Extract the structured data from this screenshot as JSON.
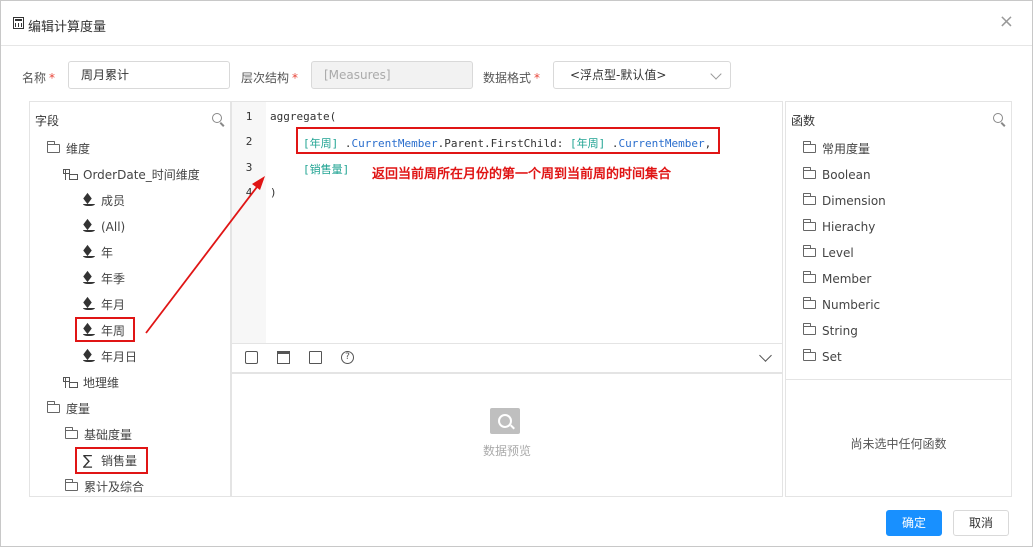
{
  "dialog": {
    "title": "编辑计算度量",
    "close_label": "×"
  },
  "form": {
    "name_label": "名称",
    "name_value": "周月累计",
    "hierarchy_label": "层次结构",
    "hierarchy_value": "[Measures]",
    "format_label": "数据格式",
    "format_value": "<浮点型-默认值>",
    "required_mark": "*"
  },
  "fields_panel": {
    "title": "字段",
    "items": [
      {
        "label": "维度",
        "icon": "folder-icon"
      },
      {
        "label": "OrderDate_时间维度",
        "icon": "hierarchy-icon"
      },
      {
        "label": "成员",
        "icon": "layers-icon"
      },
      {
        "label": "(All)",
        "icon": "layers-icon"
      },
      {
        "label": "年",
        "icon": "layers-icon"
      },
      {
        "label": "年季",
        "icon": "layers-icon"
      },
      {
        "label": "年月",
        "icon": "layers-icon"
      },
      {
        "label": "年周",
        "icon": "layers-icon"
      },
      {
        "label": "年月日",
        "icon": "layers-icon"
      },
      {
        "label": "地理维",
        "icon": "hierarchy-icon"
      },
      {
        "label": "度量",
        "icon": "folder-icon"
      },
      {
        "label": "基础度量",
        "icon": "folder-icon"
      },
      {
        "label": "销售量",
        "icon": "sigma-icon"
      },
      {
        "label": "累计及综合",
        "icon": "folder-icon"
      }
    ]
  },
  "editor": {
    "line_numbers": [
      "1",
      "2",
      "3",
      "4"
    ],
    "line1": "aggregate(",
    "line2": {
      "m1": "[年周]",
      "t1": " .",
      "f1": "CurrentMember",
      "t2": ".Parent.FirstChild: ",
      "m2": "[年周]",
      "t3": " .",
      "f2": "CurrentMember",
      "t4": ","
    },
    "line3": "[销售量]",
    "line4": ")",
    "annotation": "返回当前周所在月份的第一个周到当前周的时间集合"
  },
  "preview": {
    "text": "数据预览"
  },
  "functions_panel": {
    "title": "函数",
    "items": [
      "常用度量",
      "Boolean",
      "Dimension",
      "Hierachy",
      "Level",
      "Member",
      "Numberic",
      "String",
      "Set"
    ],
    "empty_text": "尚未选中任何函数"
  },
  "buttons": {
    "ok": "确定",
    "cancel": "取消"
  },
  "colors": {
    "accent": "#1890ff",
    "highlight": "#e01515",
    "member_token": "#1fa392",
    "function_token": "#2a6ecd"
  }
}
